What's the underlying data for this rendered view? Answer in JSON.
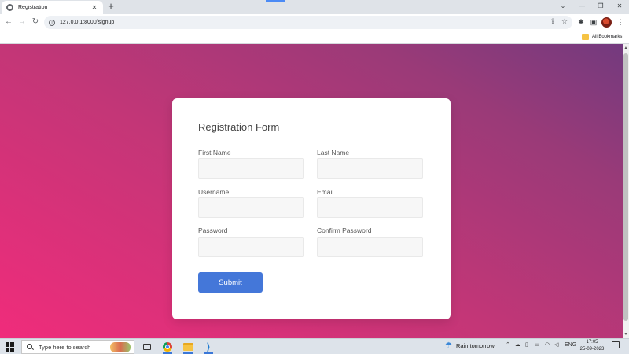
{
  "browser": {
    "tab_title": "Registration",
    "tab_close": "✕",
    "new_tab": "+",
    "url": "127.0.0.1:8000/signup",
    "bookmarks_label": "All Bookmarks",
    "window_controls": [
      "⌄",
      "—",
      "❐",
      "✕"
    ]
  },
  "form": {
    "title": "Registration Form",
    "fields": [
      {
        "label": "First Name",
        "value": ""
      },
      {
        "label": "Last Name",
        "value": ""
      },
      {
        "label": "Username",
        "value": ""
      },
      {
        "label": "Email",
        "value": ""
      },
      {
        "label": "Password",
        "value": ""
      },
      {
        "label": "Confirm Password",
        "value": ""
      }
    ],
    "submit_label": "Submit"
  },
  "taskbar": {
    "search_placeholder": "Type here to search",
    "weather": "Rain tomorrow",
    "language": "ENG",
    "time": "17:05",
    "date": "25-09-2023"
  },
  "colors": {
    "accent": "#4477d9",
    "gradient_top_right": "#733a7e",
    "gradient_bottom_left": "#f02c7b"
  }
}
